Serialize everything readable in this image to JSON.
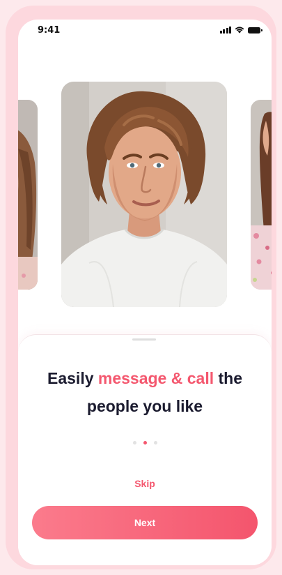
{
  "status_bar": {
    "time": "9:41",
    "icons": [
      "signal-icon",
      "wifi-icon",
      "battery-icon"
    ]
  },
  "carousel": {
    "photos": [
      {
        "name": "profile-photo-left",
        "subject": "woman with long brown hair"
      },
      {
        "name": "profile-photo-main",
        "subject": "young man with curly brown hair in white t-shirt"
      },
      {
        "name": "profile-photo-right",
        "subject": "woman in floral top"
      }
    ]
  },
  "onboarding": {
    "headline_part1": "Easily ",
    "headline_highlight": "message & call",
    "headline_part2": " the",
    "headline_line2": "people you like",
    "page_count": 3,
    "active_page": 2,
    "skip_label": "Skip",
    "next_label": "Next"
  },
  "colors": {
    "accent": "#f4586f",
    "page_background": "#fde9ec",
    "device_frame": "#fdd8de",
    "headline_text": "#1b1b2f",
    "button_gradient_start": "#fb7b8c",
    "button_gradient_end": "#f4556d"
  }
}
